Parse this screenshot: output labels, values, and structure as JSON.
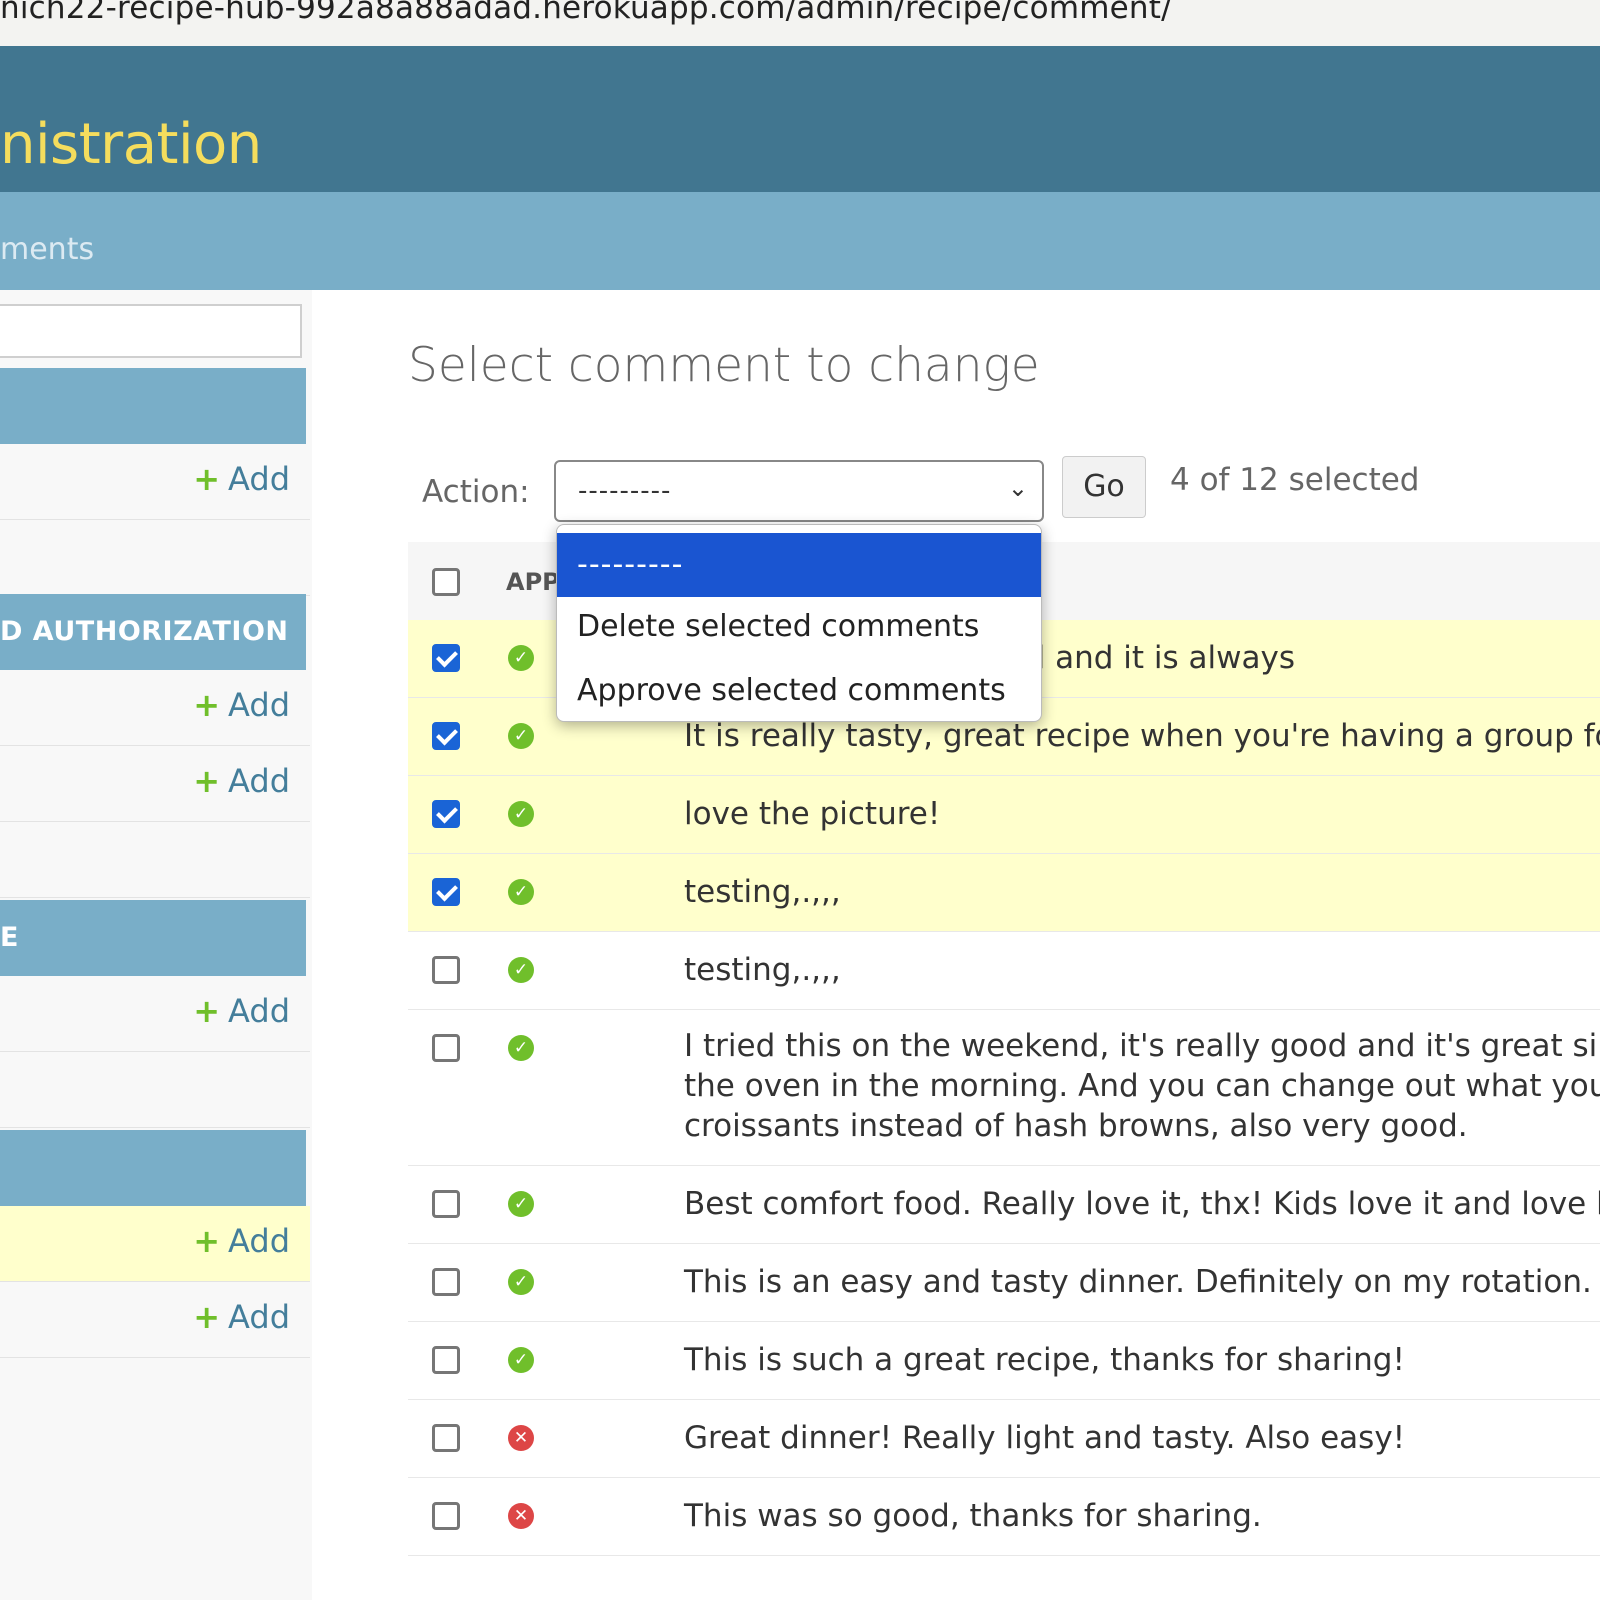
{
  "browser": {
    "url": "nich22-recipe-hub-992a8a88adad.herokuapp.com/admin/recipe/comment/"
  },
  "header": {
    "site_name": "nistration"
  },
  "breadcrumbs": {
    "text": "ments"
  },
  "sidebar": {
    "captions": [
      "",
      "D AUTHORIZATION",
      "E",
      ""
    ],
    "add_label": "Add"
  },
  "content": {
    "title": "Select comment to change",
    "actions": {
      "label": "Action:",
      "selected_value": "---------",
      "go_label": "Go",
      "selection_count": "4 of 12 selected",
      "options": [
        "---------",
        "Delete selected comments",
        "Approve selected comments"
      ]
    },
    "table": {
      "column_approved": "APP",
      "rows": [
        {
          "checked": true,
          "approved": true,
          "text": "hatever I have on hand and it is always"
        },
        {
          "checked": true,
          "approved": true,
          "text": "It is really tasty, great recipe when you're having a group for bru"
        },
        {
          "checked": true,
          "approved": true,
          "text": "love the picture!"
        },
        {
          "checked": true,
          "approved": true,
          "text": "testing,.,,,"
        },
        {
          "checked": false,
          "approved": true,
          "text": "testing,.,,,"
        },
        {
          "checked": false,
          "approved": true,
          "lines": [
            "I tried this on the weekend, it's really good and it's great since y",
            "the oven in the morning. And you can change out what you put",
            "croissants instead of hash browns, also very good."
          ]
        },
        {
          "checked": false,
          "approved": true,
          "text": "Best comfort food. Really love it, thx! Kids love it and love helpir"
        },
        {
          "checked": false,
          "approved": true,
          "text": "This is an easy and tasty dinner. Definitely on my rotation."
        },
        {
          "checked": false,
          "approved": true,
          "text": "This is such a great recipe, thanks for sharing!"
        },
        {
          "checked": false,
          "approved": false,
          "text": "Great dinner! Really light and tasty. Also easy!"
        },
        {
          "checked": false,
          "approved": false,
          "text": "This was so good, thanks for sharing."
        }
      ]
    }
  },
  "colors": {
    "header": "#417690",
    "breadcrumbs": "#79aec8",
    "site_name": "#f5dd5d",
    "selected_row": "#ffffcc",
    "approved": "#70bf2b",
    "not_approved": "#dd4646",
    "dropdown_active": "#1a55d1"
  },
  "icons": {
    "add": "plus-icon",
    "approved": "check-circle-icon",
    "not_approved": "x-circle-icon",
    "select": "chevron-down-icon"
  }
}
